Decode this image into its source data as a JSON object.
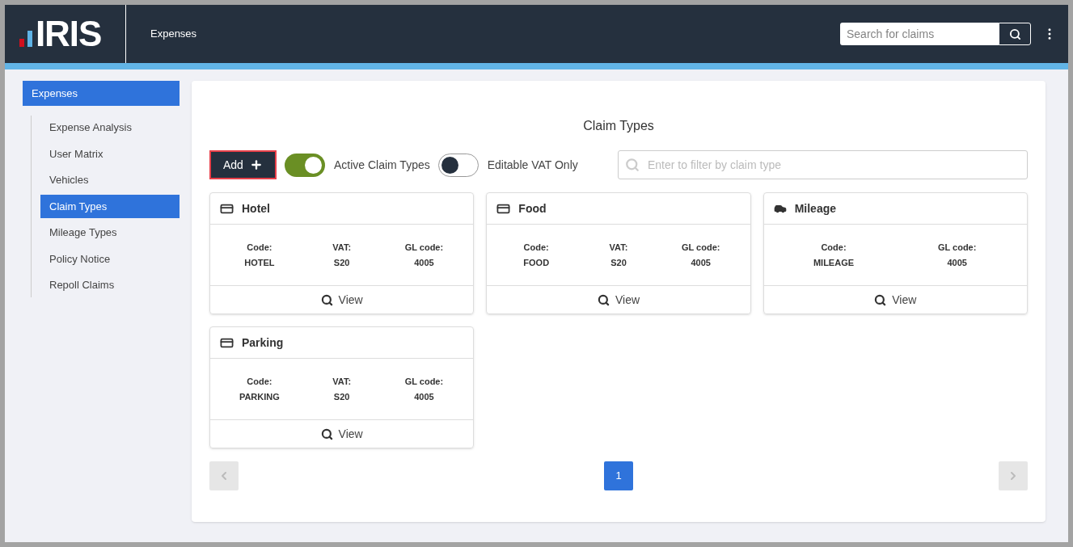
{
  "header": {
    "logo": "IRIS",
    "app_title": "Expenses",
    "search": {
      "placeholder": "Search for claims"
    }
  },
  "sidebar": {
    "section": "Expenses",
    "items": [
      {
        "label": "Expense Analysis",
        "selected": false
      },
      {
        "label": "User Matrix",
        "selected": false
      },
      {
        "label": "Vehicles",
        "selected": false
      },
      {
        "label": "Claim Types",
        "selected": true
      },
      {
        "label": "Mileage Types",
        "selected": false
      },
      {
        "label": "Policy Notice",
        "selected": false
      },
      {
        "label": "Repoll Claims",
        "selected": false
      }
    ]
  },
  "main": {
    "title": "Claim Types",
    "add_button": "Add",
    "toggles": [
      {
        "label": "Active Claim Types",
        "on": true
      },
      {
        "label": "Editable VAT Only",
        "on": false
      }
    ],
    "filter": {
      "placeholder": "Enter to filter by claim type"
    },
    "cards": [
      {
        "name": "Hotel",
        "kind": "card",
        "fields": [
          {
            "label": "Code:",
            "value": "HOTEL"
          },
          {
            "label": "VAT:",
            "value": "S20"
          },
          {
            "label": "GL code:",
            "value": "4005"
          }
        ],
        "action": "View"
      },
      {
        "name": "Food",
        "kind": "card",
        "fields": [
          {
            "label": "Code:",
            "value": "FOOD"
          },
          {
            "label": "VAT:",
            "value": "S20"
          },
          {
            "label": "GL code:",
            "value": "4005"
          }
        ],
        "action": "View"
      },
      {
        "name": "Mileage",
        "kind": "car",
        "fields": [
          {
            "label": "Code:",
            "value": "MILEAGE"
          },
          {
            "label": "GL code:",
            "value": "4005"
          }
        ],
        "action": "View"
      },
      {
        "name": "Parking",
        "kind": "card",
        "fields": [
          {
            "label": "Code:",
            "value": "PARKING"
          },
          {
            "label": "VAT:",
            "value": "S20"
          },
          {
            "label": "GL code:",
            "value": "4005"
          }
        ],
        "action": "View"
      }
    ],
    "pagination": {
      "pages": [
        {
          "label": "1",
          "selected": true
        }
      ]
    }
  }
}
